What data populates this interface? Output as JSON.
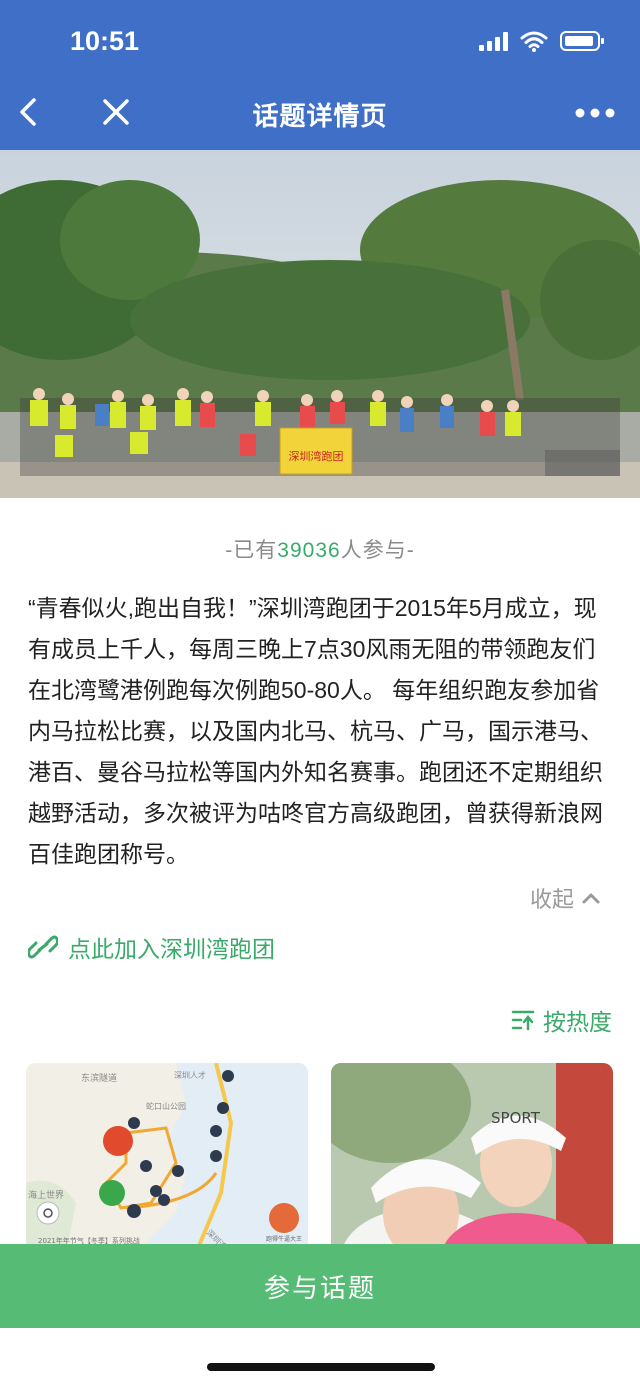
{
  "status_bar": {
    "time": "10:51"
  },
  "nav": {
    "title": "话题详情页"
  },
  "topic": {
    "participants_prefix": "-已有",
    "participants_count": "39036",
    "participants_suffix": "人参与-",
    "description": "“青春似火,跑出自我！”深圳湾跑团于2015年5月成立，现有成员上千人，每周三晚上7点30风雨无阻的带领跑友们在北湾鹭港例跑每次例跑50-80人。 每年组织跑友参加省内马拉松比赛，以及国内北马、杭马、广马，国示港马、港百、曼谷马拉松等国内外知名赛事。跑团还不定期组织越野活动，多次被评为咕咚官方高级跑团，曾获得新浪网百佳跑团称号。",
    "collapse_label": "收起",
    "join_link": "点此加入深圳湾跑团",
    "sort_label": "按热度",
    "banner_text": "深圳湾跑团"
  },
  "map_card": {
    "labels": [
      "东滨隧道",
      "海上世界",
      "深圳人才",
      "蛇口山公园",
      "深圳湾公园",
      "2021年年节气【冬季】系列挑战",
      "跑得牛逼大王"
    ]
  },
  "photo_card": {
    "cap_text": "SPORT"
  },
  "cta": {
    "label": "参与话题"
  },
  "colors": {
    "header": "#3f6fc6",
    "accent": "#3aaa6a",
    "cta": "#56bb74"
  }
}
